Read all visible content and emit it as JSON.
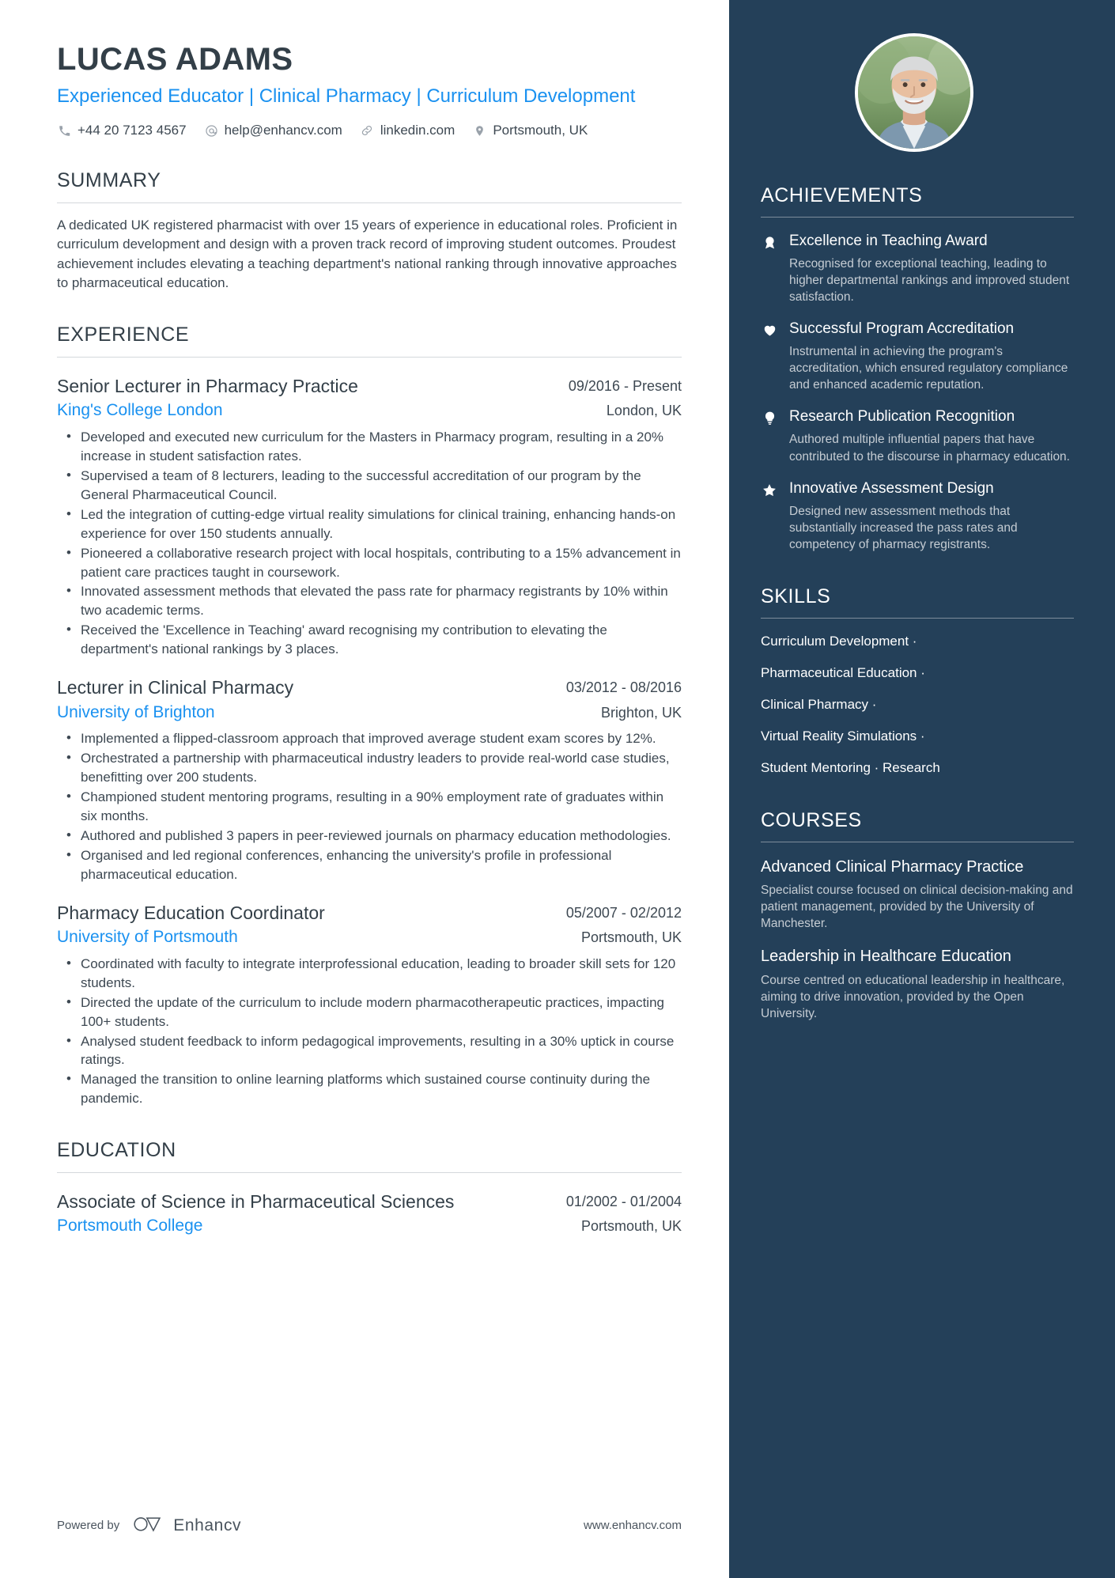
{
  "header": {
    "name": "LUCAS ADAMS",
    "headline": "Experienced Educator | Clinical Pharmacy | Curriculum Development",
    "contacts": [
      {
        "icon": "phone-icon",
        "text": "+44 20 7123 4567"
      },
      {
        "icon": "email-icon",
        "text": "help@enhancv.com"
      },
      {
        "icon": "link-icon",
        "text": "linkedin.com"
      },
      {
        "icon": "location-pin-icon",
        "text": "Portsmouth, UK"
      }
    ]
  },
  "summary": {
    "title": "SUMMARY",
    "text": "A dedicated UK registered pharmacist with over 15 years of experience in educational roles. Proficient in curriculum development and design with a proven track record of improving student outcomes. Proudest achievement includes elevating a teaching department's national ranking through innovative approaches to pharmaceutical education."
  },
  "experience": {
    "title": "EXPERIENCE",
    "entries": [
      {
        "role": "Senior Lecturer in Pharmacy Practice",
        "dates": "09/2016 - Present",
        "organization": "King's College London",
        "location": "London, UK",
        "bullets": [
          "Developed and executed new curriculum for the Masters in Pharmacy program, resulting in a 20% increase in student satisfaction rates.",
          "Supervised a team of 8 lecturers, leading to the successful accreditation of our program by the General Pharmaceutical Council.",
          "Led the integration of cutting-edge virtual reality simulations for clinical training, enhancing hands-on experience for over 150 students annually.",
          "Pioneered a collaborative research project with local hospitals, contributing to a 15% advancement in patient care practices taught in coursework.",
          "Innovated assessment methods that elevated the pass rate for pharmacy registrants by 10% within two academic terms.",
          "Received the 'Excellence in Teaching' award recognising my contribution to elevating the department's national rankings by 3 places."
        ]
      },
      {
        "role": "Lecturer in Clinical Pharmacy",
        "dates": "03/2012 - 08/2016",
        "organization": "University of Brighton",
        "location": "Brighton, UK",
        "bullets": [
          "Implemented a flipped-classroom approach that improved average student exam scores by 12%.",
          "Orchestrated a partnership with pharmaceutical industry leaders to provide real-world case studies, benefitting over 200 students.",
          "Championed student mentoring programs, resulting in a 90% employment rate of graduates within six months.",
          "Authored and published 3 papers in peer-reviewed journals on pharmacy education methodologies.",
          "Organised and led regional conferences, enhancing the university's profile in professional pharmaceutical education."
        ]
      },
      {
        "role": "Pharmacy Education Coordinator",
        "dates": "05/2007 - 02/2012",
        "organization": "University of Portsmouth",
        "location": "Portsmouth, UK",
        "bullets": [
          "Coordinated with faculty to integrate interprofessional education, leading to broader skill sets for 120 students.",
          "Directed the update of the curriculum to include modern pharmacotherapeutic practices, impacting 100+ students.",
          "Analysed student feedback to inform pedagogical improvements, resulting in a 30% uptick in course ratings.",
          "Managed the transition to online learning platforms which sustained course continuity during the pandemic."
        ]
      }
    ]
  },
  "education": {
    "title": "EDUCATION",
    "entries": [
      {
        "degree": "Associate of Science in Pharmaceutical Sciences",
        "dates": "01/2002 - 01/2004",
        "organization": "Portsmouth College",
        "location": "Portsmouth, UK"
      }
    ]
  },
  "achievements": {
    "title": "ACHIEVEMENTS",
    "items": [
      {
        "icon": "award-badge-icon",
        "title": "Excellence in Teaching Award",
        "description": "Recognised for exceptional teaching, leading to higher departmental rankings and improved student satisfaction."
      },
      {
        "icon": "heart-icon",
        "title": "Successful Program Accreditation",
        "description": "Instrumental in achieving the program's accreditation, which ensured regulatory compliance and enhanced academic reputation."
      },
      {
        "icon": "lightbulb-icon",
        "title": "Research Publication Recognition",
        "description": "Authored multiple influential papers that have contributed to the discourse in pharmacy education."
      },
      {
        "icon": "star-icon",
        "title": "Innovative Assessment Design",
        "description": "Designed new assessment methods that substantially increased the pass rates and competency of pharmacy registrants."
      }
    ]
  },
  "skills": {
    "title": "SKILLS",
    "lines": [
      "Curriculum Development ·",
      "Pharmaceutical Education ·",
      "Clinical Pharmacy ·",
      "Virtual Reality Simulations ·",
      "Student Mentoring · Research"
    ]
  },
  "courses": {
    "title": "COURSES",
    "items": [
      {
        "title": "Advanced Clinical Pharmacy Practice",
        "description": "Specialist course focused on clinical decision-making and patient management, provided by the University of Manchester."
      },
      {
        "title": "Leadership in Healthcare Education",
        "description": "Course centred on educational leadership in healthcare, aiming to drive innovation, provided by the Open University."
      }
    ]
  },
  "footer": {
    "powered_by": "Powered by",
    "brand": "Enhancv",
    "url": "www.enhancv.com"
  },
  "colors": {
    "sidebar_bg": "#244059",
    "accent_blue": "#1a91f0",
    "heading": "#333f48",
    "body_text": "#3d4852",
    "muted_side": "#c5ccd3"
  }
}
